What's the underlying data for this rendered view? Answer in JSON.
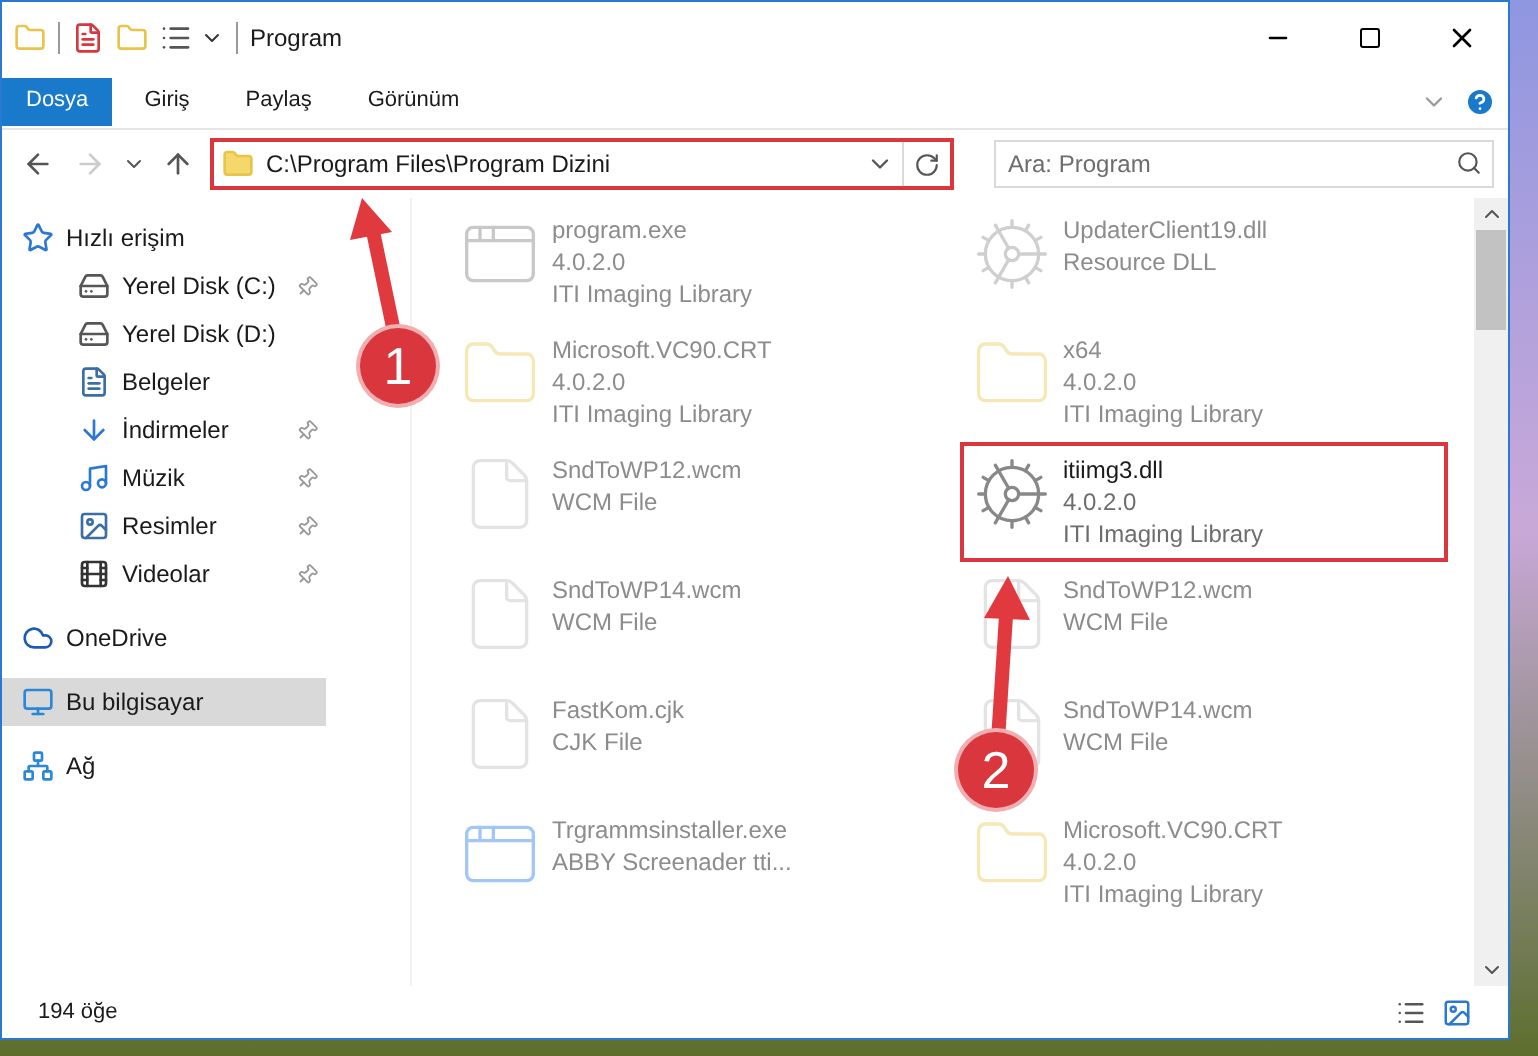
{
  "window": {
    "title": "Program"
  },
  "ribbon_tabs": [
    {
      "label": "Dosya",
      "selected": true
    },
    {
      "label": "Giriş",
      "selected": false
    },
    {
      "label": "Paylaş",
      "selected": false
    },
    {
      "label": "Görünüm",
      "selected": false
    }
  ],
  "address_bar": {
    "path": "C:\\Program Files\\Program Dizini",
    "highlighted": true
  },
  "search": {
    "placeholder": "Ara: Program"
  },
  "sidebar": {
    "items": [
      {
        "label": "Hızlı erişim",
        "kind": "star",
        "selected": false,
        "pinned": false,
        "children": [
          {
            "label": "Yerel Disk (C:)",
            "kind": "drive",
            "selected": false,
            "pinned": true
          },
          {
            "label": "Yerel Disk (D:)",
            "kind": "drive",
            "selected": false,
            "pinned": false
          },
          {
            "label": "Belgeler",
            "kind": "document",
            "selected": false,
            "pinned": false
          },
          {
            "label": "İndirmeler",
            "kind": "download",
            "selected": false,
            "pinned": true
          },
          {
            "label": "Müzik",
            "kind": "music",
            "selected": false,
            "pinned": true
          },
          {
            "label": "Resimler",
            "kind": "picture",
            "selected": false,
            "pinned": true
          },
          {
            "label": "Videolar",
            "kind": "video",
            "selected": false,
            "pinned": true
          }
        ]
      },
      {
        "label": "OneDrive",
        "kind": "cloud",
        "selected": false,
        "pinned": false
      },
      {
        "label": "Bu bilgisayar",
        "kind": "computer",
        "selected": true,
        "pinned": false
      },
      {
        "label": "Ağ",
        "kind": "network",
        "selected": false,
        "pinned": false
      }
    ]
  },
  "files": [
    {
      "name": "program.exe",
      "lines": [
        "4.0.2.0",
        "ITI Imaging Library"
      ],
      "kind": "exe",
      "blurred": true,
      "highlighted": false
    },
    {
      "name": "UpdaterClient19.dll",
      "lines": [
        "Resource DLL"
      ],
      "kind": "dll",
      "blurred": true,
      "highlighted": false
    },
    {
      "name": "Microsoft.VC90.CRT",
      "lines": [
        "4.0.2.0",
        "ITI Imaging Library"
      ],
      "kind": "folder",
      "blurred": true,
      "highlighted": false
    },
    {
      "name": "x64",
      "lines": [
        "4.0.2.0",
        "ITI Imaging Library"
      ],
      "kind": "folder",
      "blurred": true,
      "highlighted": false
    },
    {
      "name": "SndToWP12.wcm",
      "lines": [
        "WCM File"
      ],
      "kind": "file",
      "blurred": true,
      "highlighted": false
    },
    {
      "name": "itiimg3.dll",
      "lines": [
        "4.0.2.0",
        "ITI Imaging Library"
      ],
      "kind": "dll",
      "blurred": false,
      "highlighted": true
    },
    {
      "name": "SndToWP14.wcm",
      "lines": [
        "WCM File"
      ],
      "kind": "file",
      "blurred": true,
      "highlighted": false
    },
    {
      "name": "SndToWP12.wcm",
      "lines": [
        "WCM File"
      ],
      "kind": "file",
      "blurred": true,
      "highlighted": false
    },
    {
      "name": "FastKom.cjk",
      "lines": [
        "CJK File"
      ],
      "kind": "file",
      "blurred": true,
      "highlighted": false
    },
    {
      "name": "SndToWP14.wcm",
      "lines": [
        "WCM File"
      ],
      "kind": "file",
      "blurred": true,
      "highlighted": false
    },
    {
      "name": "Trgrammsinstaller.exe",
      "lines": [
        "ABBY Screenader tti..."
      ],
      "kind": "installer",
      "blurred": true,
      "highlighted": false
    },
    {
      "name": "Microsoft.VC90.CRT",
      "lines": [
        "4.0.2.0",
        "ITI Imaging Library"
      ],
      "kind": "folder",
      "blurred": true,
      "highlighted": false
    }
  ],
  "annotations": [
    {
      "label": "1"
    },
    {
      "label": "2"
    }
  ],
  "status_bar": {
    "count": "194 öğe"
  }
}
